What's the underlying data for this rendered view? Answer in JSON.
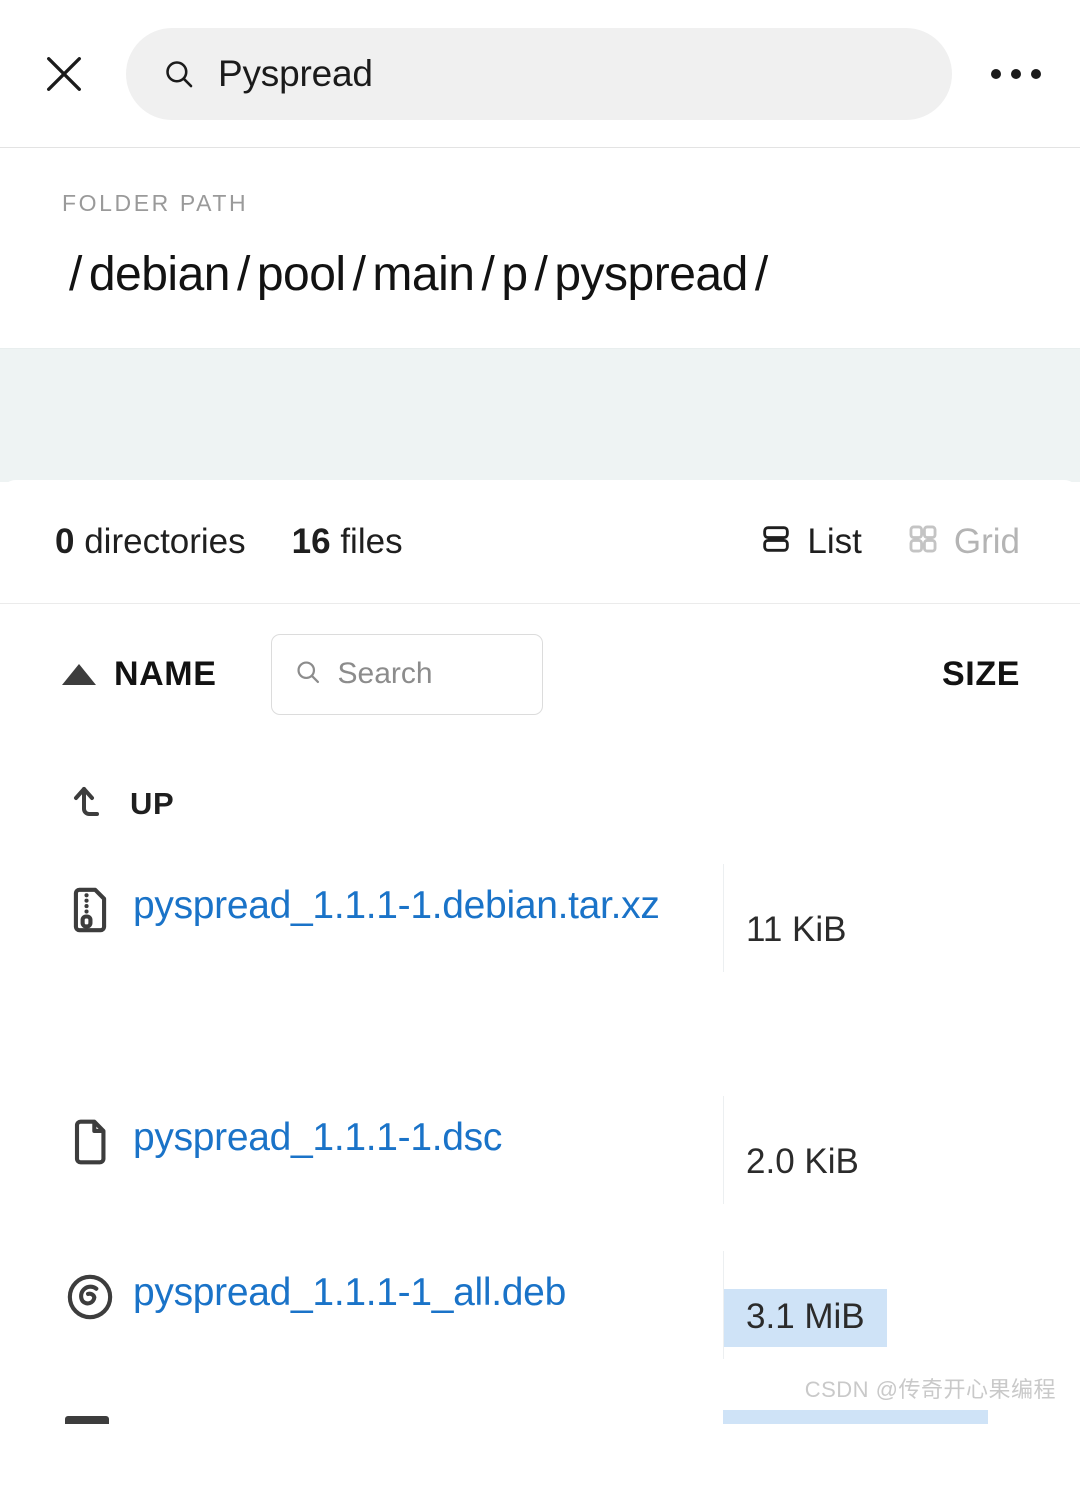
{
  "topbar": {
    "close_icon": "close-x-icon",
    "search_icon": "search-icon",
    "query": "Pyspread",
    "overflow_icon": "more-horizontal-icon"
  },
  "breadcrumb": {
    "label": "FOLDER PATH",
    "segments": [
      "debian",
      "pool",
      "main",
      "p",
      "pyspread"
    ],
    "separator": "/"
  },
  "stats": {
    "dir_count": "0",
    "dir_unit": "directories",
    "file_count": "16",
    "file_unit": "files"
  },
  "views": [
    {
      "label": "List",
      "icon": "list-view-icon",
      "active": true
    },
    {
      "label": "Grid",
      "icon": "grid-view-icon",
      "active": false
    }
  ],
  "table": {
    "sort_icon": "sort-ascending-icon",
    "name_header": "NAME",
    "size_header": "SIZE",
    "search_placeholder": "Search",
    "search_icon": "search-icon",
    "search_value": ""
  },
  "up_row": {
    "icon": "arrow-turn-up-icon",
    "label": "UP"
  },
  "files": [
    {
      "name": "pyspread_1.1.1-1.debian.tar.xz",
      "size": "11 KiB",
      "icon": "archive-zip-icon",
      "highlighted": false
    },
    {
      "name": "pyspread_1.1.1-1.dsc",
      "size": "2.0 KiB",
      "icon": "document-file-icon",
      "highlighted": false
    },
    {
      "name": "pyspread_1.1.1-1_all.deb",
      "size": "3.1 MiB",
      "icon": "debian-package-icon",
      "highlighted": true
    }
  ],
  "watermark": "CSDN @传奇开心果编程",
  "colors": {
    "link": "#1a73c8",
    "highlight": "#cfe3f7",
    "band": "#eef3f3",
    "pill": "#f0f0f0",
    "muted": "#9a9a9a"
  }
}
